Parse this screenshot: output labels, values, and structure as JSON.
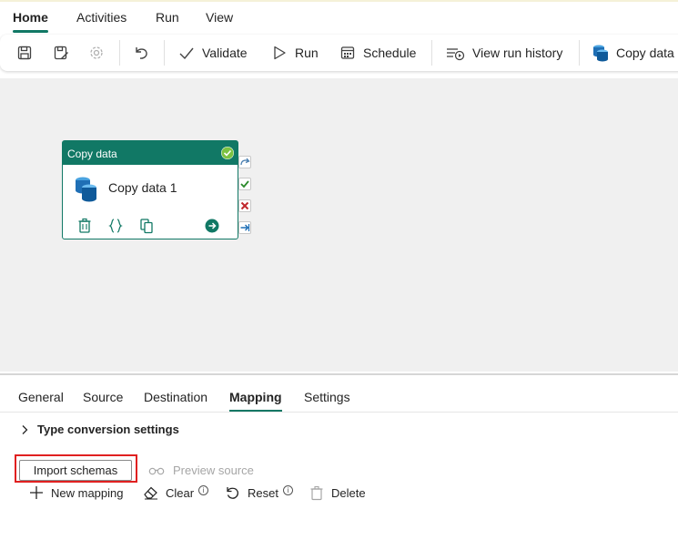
{
  "menu": {
    "tabs": [
      "Home",
      "Activities",
      "Run",
      "View"
    ]
  },
  "toolbar": {
    "validate_label": "Validate",
    "run_label": "Run",
    "schedule_label": "Schedule",
    "view_run_history_label": "View run history",
    "copy_data_label": "Copy data"
  },
  "node": {
    "type_label": "Copy data",
    "name": "Copy data 1"
  },
  "panel": {
    "tabs": [
      "General",
      "Source",
      "Destination",
      "Mapping",
      "Settings"
    ],
    "active_tab": "Mapping",
    "type_conversion_label": "Type conversion settings",
    "import_schemas_label": "Import schemas",
    "preview_source_label": "Preview source",
    "actions": {
      "new_mapping": "New mapping",
      "clear": "Clear",
      "reset": "Reset",
      "delete": "Delete"
    }
  },
  "colors": {
    "accent": "#117865",
    "highlight_outline": "#e02020"
  }
}
